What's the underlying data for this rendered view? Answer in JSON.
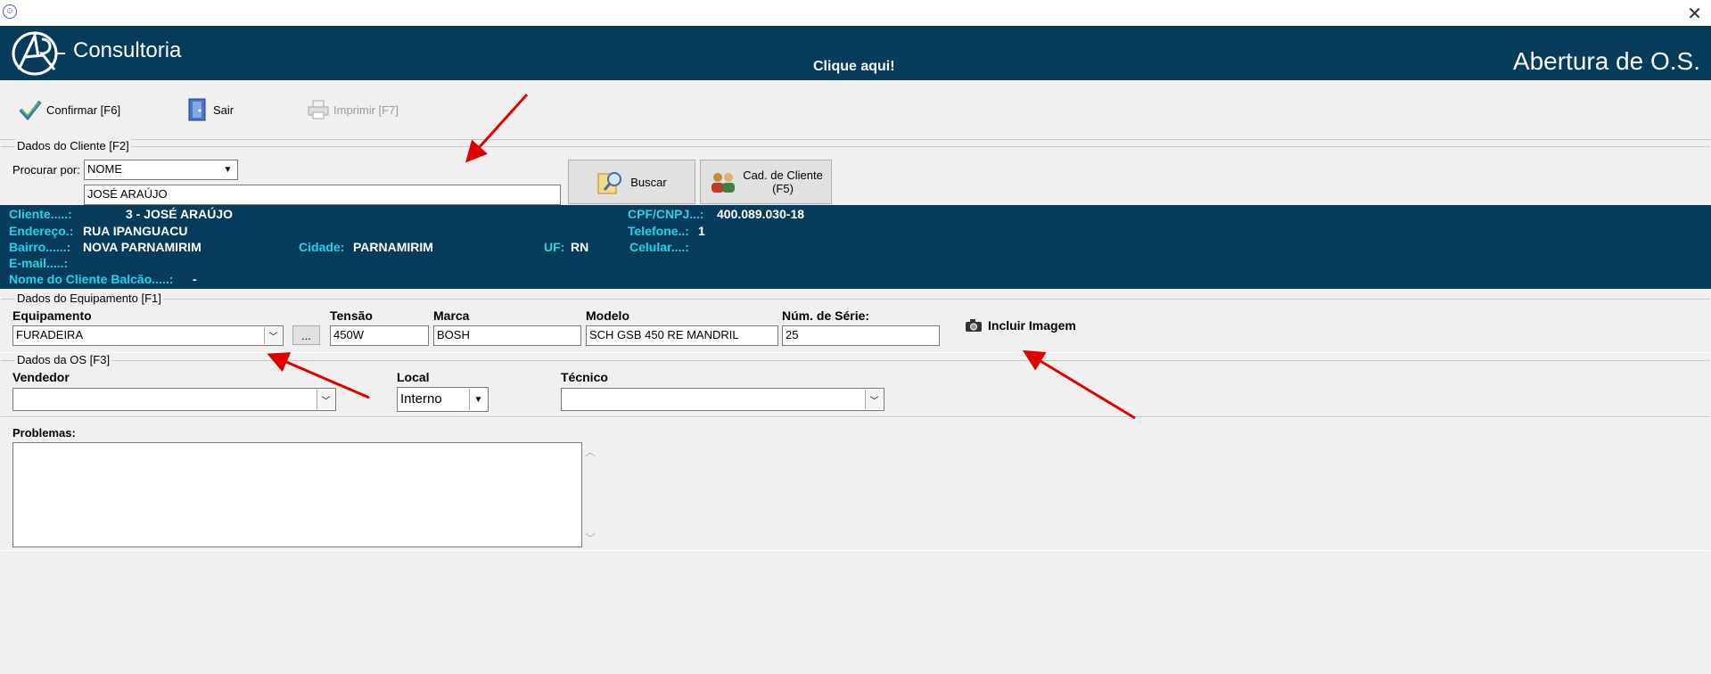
{
  "window": {
    "close_icon": "close-icon",
    "app_icon": "app-icon"
  },
  "header": {
    "brand": "Consultoria",
    "clique": "Clique aqui!",
    "title": "Abertura de O.S.",
    "background": "#073b5b"
  },
  "toolbar": {
    "confirmar": "Confirmar [F6]",
    "sair": "Sair",
    "imprimir": "Imprimir  [F7]"
  },
  "cliente": {
    "group_title": "Dados do Cliente [F2]",
    "procurar_label": "Procurar por:",
    "procurar_value": "NOME",
    "search_value": "JOSÉ ARAÚJO",
    "buscar": "Buscar",
    "cad_line1": "Cad. de Cliente",
    "cad_line2": "(F5)"
  },
  "info": {
    "cliente_label": "Cliente.....:",
    "cliente_value": "3 - JOSÉ ARAÚJO",
    "endereco_label": "Endereço.:",
    "endereco_value": "RUA IPANGUACU",
    "bairro_label": "Bairro......:",
    "bairro_value": "NOVA PARNAMIRIM",
    "cidade_label": "Cidade:",
    "cidade_value": "PARNAMIRIM",
    "uf_label": "UF:",
    "uf_value": "RN",
    "email_label": "E-mail.....:",
    "balcao_label": "Nome do Cliente Balcão.....:",
    "balcao_value": "-",
    "cpf_label": "CPF/CNPJ...:",
    "cpf_value": "400.089.030-18",
    "telefone_label": "Telefone..:",
    "telefone_value": "1",
    "celular_label": "Celular....:",
    "label_color": "#24d3e6"
  },
  "equip": {
    "group_title": "Dados do Equipamento [F1]",
    "equipamento_label": "Equipamento",
    "equipamento_value": "FURADEIRA",
    "ellipsis": "...",
    "tensao_label": "Tensão",
    "tensao_value": "450W",
    "marca_label": "Marca",
    "marca_value": "BOSH",
    "modelo_label": "Modelo",
    "modelo_value": "SCH GSB 450 RE MANDRIL",
    "serie_label": "Núm. de Série:",
    "serie_value": "25",
    "incluir": "Incluir Imagem"
  },
  "os": {
    "group_title": "Dados da OS [F3]",
    "vendedor_label": "Vendedor",
    "local_label": "Local",
    "local_value": "Interno",
    "tecnico_label": "Técnico"
  },
  "problemas": {
    "label": "Problemas:"
  }
}
